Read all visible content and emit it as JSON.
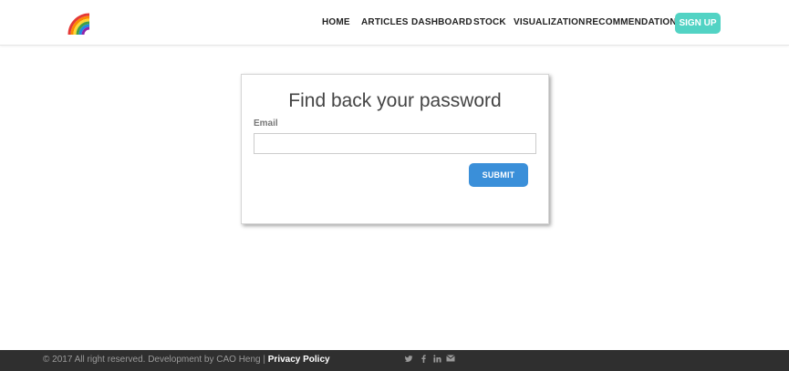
{
  "nav": {
    "items": [
      {
        "label": "HOME"
      },
      {
        "label": "ARTICLES"
      },
      {
        "label": "DASHBOARD"
      },
      {
        "label": "STOCK"
      },
      {
        "label": "VISUALIZATION"
      },
      {
        "label": "RECOMMENDATION"
      }
    ],
    "signup_label": "SIGN UP",
    "logo_icon": "rainbow-icon"
  },
  "form": {
    "title": "Find back your password",
    "email_label": "Email",
    "email_value": "",
    "submit_label": "SUBMIT"
  },
  "footer": {
    "copyright": "© 2017 All right reserved. Development by CAO Heng | ",
    "privacy_label": "Privacy Policy",
    "social_icons": [
      "twitter-icon",
      "facebook-icon",
      "linkedin-icon",
      "envelope-icon"
    ]
  },
  "colors": {
    "signup_bg": "#52d3c4",
    "submit_bg": "#3a8fd9",
    "footer_bg": "#2f2f2f"
  }
}
